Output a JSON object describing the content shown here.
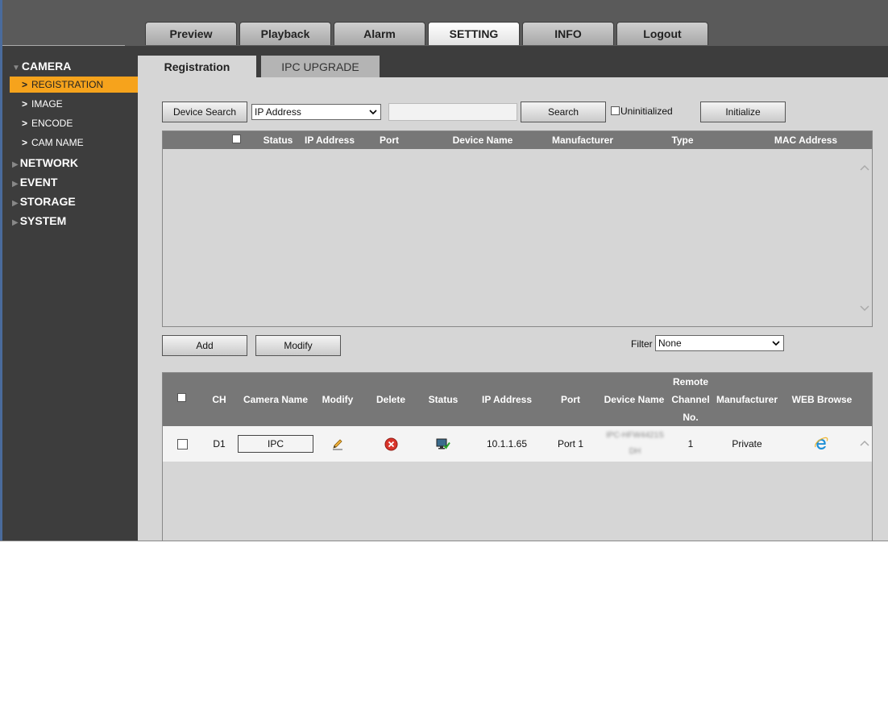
{
  "main_tabs": [
    "Preview",
    "Playback",
    "Alarm",
    "SETTING",
    "INFO",
    "Logout"
  ],
  "active_main_tab": "SETTING",
  "sidebar": {
    "camera": "CAMERA",
    "camera_items": [
      "REGISTRATION",
      "IMAGE",
      "ENCODE",
      "CAM NAME"
    ],
    "network": "NETWORK",
    "event": "EVENT",
    "storage": "STORAGE",
    "system": "SYSTEM"
  },
  "sub_tabs": [
    "Registration",
    "IPC UPGRADE"
  ],
  "search_bar": {
    "device_search": "Device Search",
    "search_type": "IP Address",
    "search_input": "",
    "search": "Search",
    "uninitialized": "Uninitialized",
    "initialize": "Initialize"
  },
  "search_table": {
    "headers": [
      "Status",
      "IP Address",
      "Port",
      "Device Name",
      "Manufacturer",
      "Type",
      "MAC Address"
    ]
  },
  "actions": {
    "add": "Add",
    "modify": "Modify",
    "filter_label": "Filter",
    "filter_value": "None"
  },
  "device_table": {
    "headers": {
      "ch": "CH",
      "camera_name": "Camera Name",
      "modify": "Modify",
      "delete": "Delete",
      "status": "Status",
      "ip_address": "IP Address",
      "port": "Port",
      "device_name": "Device Name",
      "remote_line1": "Remote",
      "remote_line2": "Channel",
      "remote_line3": "No.",
      "manufacturer": "Manufacturer",
      "web_browse": "WEB Browse"
    },
    "rows": [
      {
        "ch": "D1",
        "camera_name": "IPC",
        "ip_address": "10.1.1.65",
        "port": "Port 1",
        "device_name_line1": "IPC-HFW4421S",
        "device_name_line2": "DH",
        "remote_channel": "1",
        "manufacturer": "Private"
      }
    ]
  },
  "colors": {
    "accent": "#f6a31c",
    "sidebar_bg": "#3d3d3d",
    "header_bg": "#777777",
    "content_bg": "#d6d6d6"
  },
  "icons": {
    "modify": "pencil-icon",
    "delete": "delete-icon",
    "status": "monitor-online-icon",
    "web_browse": "ie-browser-icon"
  }
}
